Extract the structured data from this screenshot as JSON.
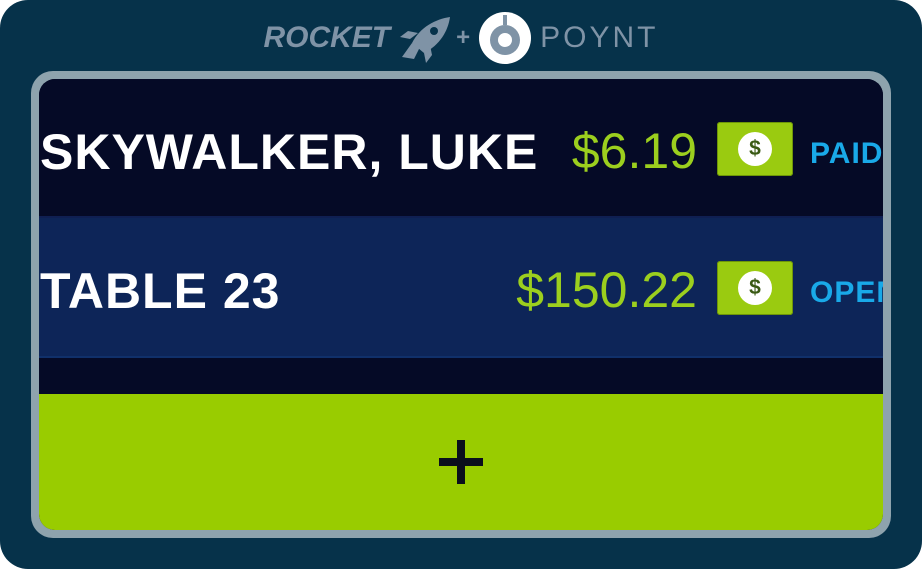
{
  "brand": {
    "rocket_label": "ROCKET",
    "plus_label": "+",
    "poynt_label": "POYNT",
    "rocket_icon": "rocket-icon",
    "poynt_icon": "poynt-logo-icon"
  },
  "tabs": [
    {
      "name": "SKYWALKER, LUKE",
      "amount": "$6.19",
      "pay_icon": "dollar-icon",
      "pay_symbol": "$",
      "status": "PAID"
    },
    {
      "name": "TABLE 23",
      "amount": "$150.22",
      "pay_icon": "dollar-icon",
      "pay_symbol": "$",
      "status": "OPEN"
    }
  ],
  "add_button": {
    "icon": "plus-icon"
  },
  "colors": {
    "frame": "#06324a",
    "accent_green": "#99cc00",
    "amount_green": "#9ccf1e",
    "status_blue": "#19a9e8",
    "row_dark": "#050a26",
    "row_highlight": "#0d2558"
  }
}
